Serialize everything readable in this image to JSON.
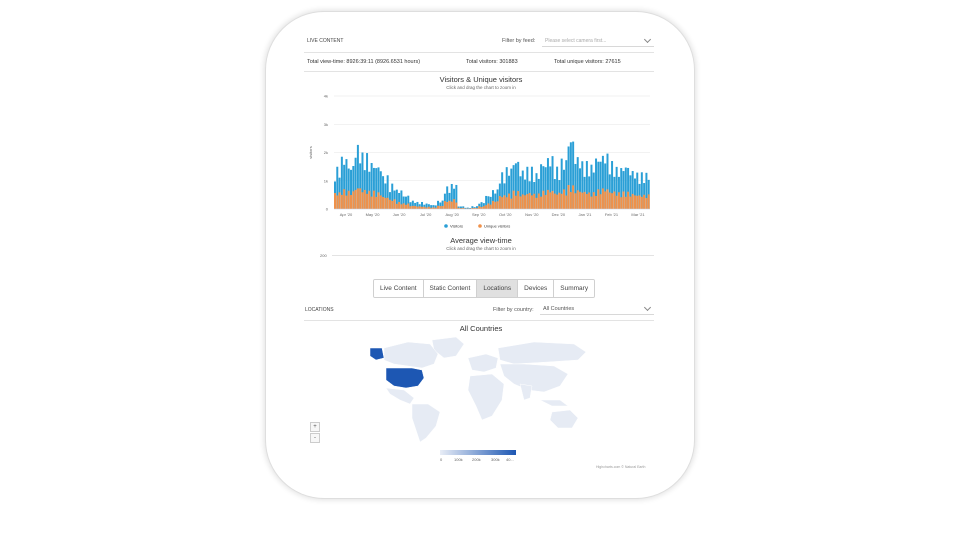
{
  "header": {
    "section_title": "LIVE CONTENT",
    "filter_label": "Filter by feed:",
    "filter_placeholder": "Please select camera first..."
  },
  "stats": {
    "view_time": "Total view-time: 8926:39:11 (8926.6531 hours)",
    "visitors": "Total visitors: 301883",
    "unique": "Total unique visitors: 27615"
  },
  "visitors_chart": {
    "title": "Visitors & Unique visitors",
    "subtitle": "Click and drag the chart to zoom in",
    "credit": "Highcharts.com"
  },
  "chart_data": [
    {
      "type": "area",
      "title": "Visitors & Unique visitors",
      "subtitle": "Click and drag the chart to zoom in",
      "ylabel": "visitors",
      "ylim": [
        0,
        4000
      ],
      "yticks": [
        "0",
        "1k",
        "2k",
        "3k",
        "4k"
      ],
      "xticks": [
        "Apr '20",
        "May '20",
        "Jun '20",
        "Jul '20",
        "Aug '20",
        "Sep '20",
        "Oct '20",
        "Nov '20",
        "Dec '20",
        "Jan '21",
        "Feb '21",
        "Mar '21"
      ],
      "grid": true,
      "legend": "bottom-center",
      "series": [
        {
          "name": "Visitors",
          "color": "#2a9fd6",
          "values": [
            1500,
            1900,
            1600,
            2300,
            2000,
            1700,
            1600,
            1200,
            900,
            700,
            500,
            300,
            250,
            200,
            150,
            300,
            800,
            900,
            100,
            50,
            100,
            250,
            500,
            700,
            1300,
            1500,
            1800,
            1400,
            1500,
            1300,
            1700,
            1900,
            1500,
            1800,
            2600,
            1900,
            1700,
            1600,
            1900,
            2000,
            1700,
            1500,
            1600,
            1400,
            1300,
            1300
          ]
        },
        {
          "name": "Unique visitors",
          "color": "#f0914a",
          "values": [
            600,
            700,
            650,
            800,
            700,
            650,
            600,
            450,
            350,
            250,
            200,
            120,
            100,
            80,
            60,
            120,
            300,
            350,
            40,
            20,
            40,
            100,
            200,
            300,
            500,
            550,
            650,
            550,
            600,
            550,
            650,
            700,
            600,
            700,
            850,
            700,
            650,
            600,
            700,
            750,
            650,
            600,
            620,
            560,
            520,
            520
          ]
        }
      ]
    },
    {
      "type": "line",
      "title": "Average view-time",
      "subtitle": "Click and drag the chart to zoom in",
      "yticks": [
        "200"
      ]
    }
  ],
  "viewtime_chart": {
    "title": "Average view-time",
    "subtitle": "Click and drag the chart to zoom in"
  },
  "tabs": [
    {
      "label": "Live Content"
    },
    {
      "label": "Static Content"
    },
    {
      "label": "Locations",
      "active": true
    },
    {
      "label": "Devices"
    },
    {
      "label": "Summary"
    }
  ],
  "locations": {
    "section_title": "LOCATIONS",
    "filter_label": "Filter by country:",
    "filter_value": "All Countries",
    "map_title": "All Countries",
    "zoom_in": "+",
    "zoom_out": "-",
    "color_axis": [
      "0",
      "100k",
      "200k",
      "300k",
      "40..."
    ],
    "credit": "Highcharts.com © Natural Earth",
    "highlight_color": "#1d57b3"
  }
}
